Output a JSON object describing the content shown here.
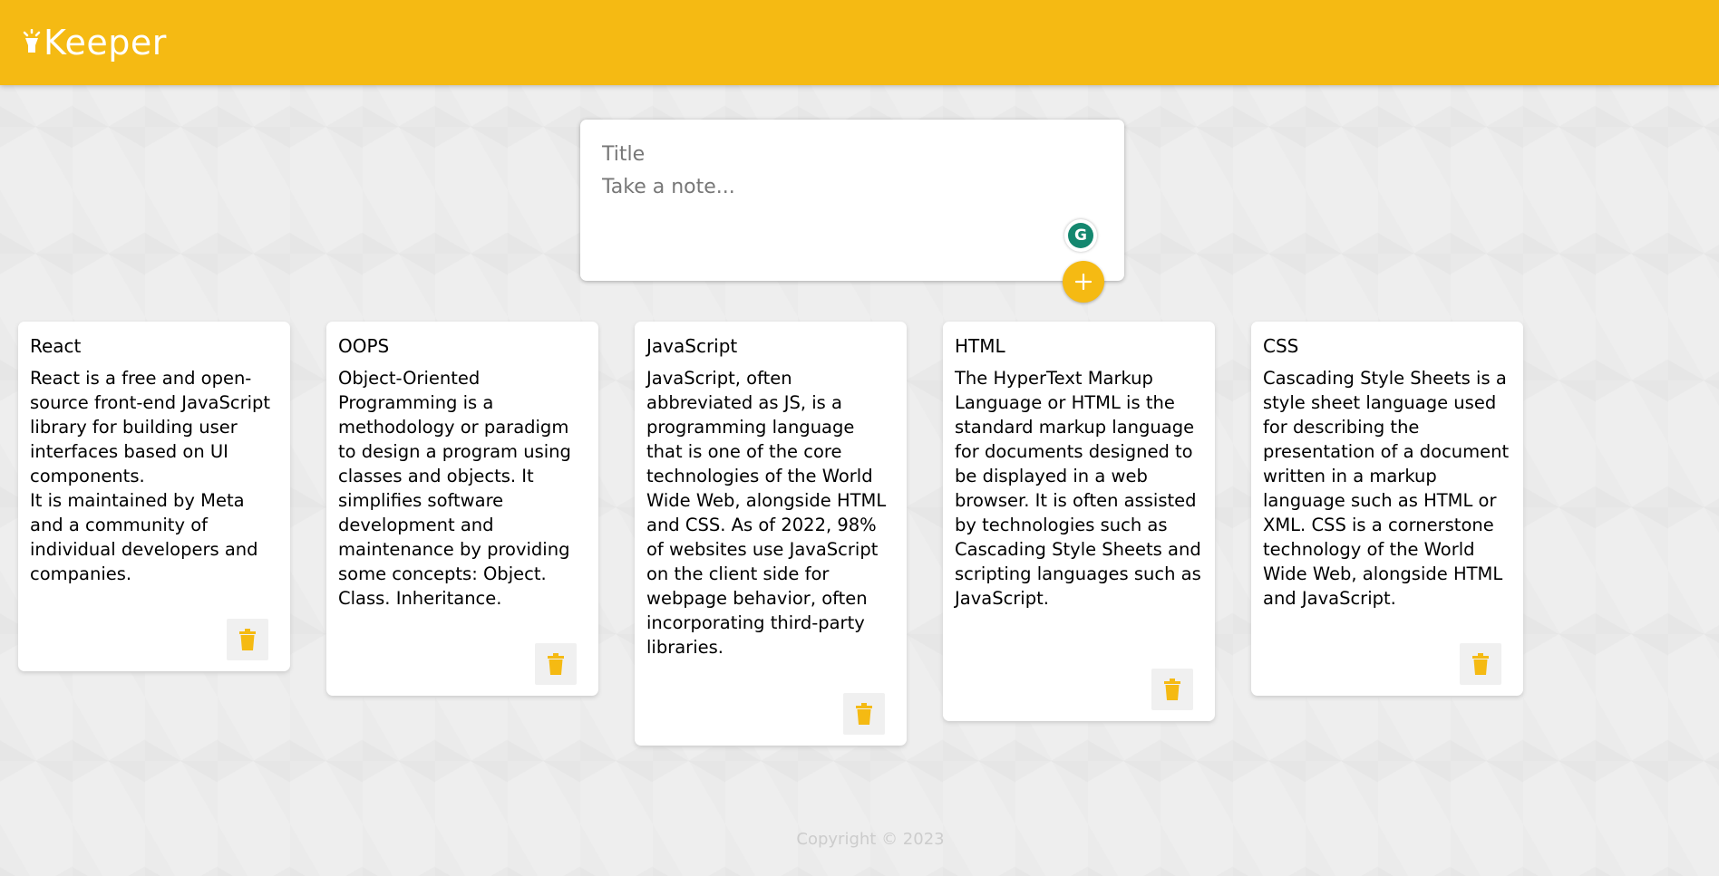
{
  "header": {
    "title": "Keeper",
    "icon": "lightbulb-icon",
    "accent_color": "#f5ba13"
  },
  "create_area": {
    "title_placeholder": "Title",
    "content_placeholder": "Take a note...",
    "add_icon": "plus-icon",
    "grammarly_letter": "G"
  },
  "notes": [
    {
      "title": "React",
      "content": "React is a free and open-source front-end JavaScript library for building user interfaces based on UI components.\nIt is maintained by Meta and a community of individual developers and companies.",
      "delete_icon": "trash-icon"
    },
    {
      "title": "OOPS",
      "content": "Object-Oriented Programming is a methodology or paradigm to design a program using classes and objects. It simplifies software development and maintenance by providing some concepts: Object. Class. Inheritance.",
      "delete_icon": "trash-icon"
    },
    {
      "title": "JavaScript",
      "content": "JavaScript, often abbreviated as JS, is a programming language that is one of the core technologies of the World Wide Web, alongside HTML and CSS. As of 2022, 98% of websites use JavaScript on the client side for webpage behavior, often incorporating third-party libraries.",
      "delete_icon": "trash-icon"
    },
    {
      "title": "HTML",
      "content": "The HyperText Markup Language or HTML is the standard markup language for documents designed to be displayed in a web browser. It is often assisted by technologies such as Cascading Style Sheets and scripting languages such as JavaScript.",
      "delete_icon": "trash-icon"
    },
    {
      "title": "CSS",
      "content": "Cascading Style Sheets is a style sheet language used for describing the presentation of a document written in a markup language such as HTML or XML. CSS is a cornerstone technology of the World Wide Web, alongside HTML and JavaScript.",
      "delete_icon": "trash-icon"
    }
  ],
  "footer": {
    "copyright": "Copyright © 2023"
  }
}
